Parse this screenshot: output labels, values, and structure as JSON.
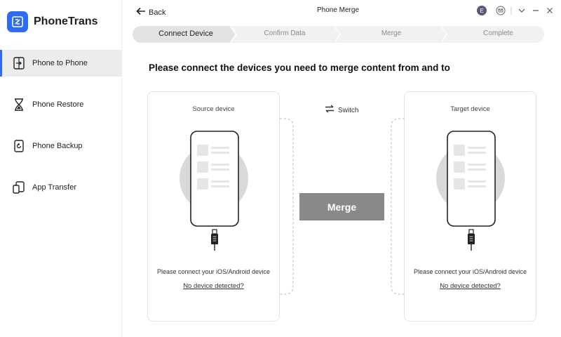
{
  "app": {
    "name": "PhoneTrans",
    "brand_color": "#2f6cf6"
  },
  "sidebar": {
    "items": [
      {
        "label": "Phone to Phone",
        "icon": "phone-to-phone-icon",
        "active": true
      },
      {
        "label": "Phone Restore",
        "icon": "hourglass-icon",
        "active": false
      },
      {
        "label": "Phone Backup",
        "icon": "backup-icon",
        "active": false
      },
      {
        "label": "App Transfer",
        "icon": "app-transfer-icon",
        "active": false
      }
    ]
  },
  "titlebar": {
    "back_label": "Back",
    "title": "Phone Merge",
    "avatar_letter": "E"
  },
  "steps": [
    "Connect Device",
    "Confirm Data",
    "Merge",
    "Complete"
  ],
  "active_step": "Connect Device",
  "headline": "Please connect the devices you need to merge content from and to",
  "switch_label": "Switch",
  "merge_label": "Merge",
  "source": {
    "title": "Source device",
    "message": "Please connect your iOS/Android device",
    "link": "No device detected?"
  },
  "target": {
    "title": "Target device",
    "message": "Please connect your iOS/Android device",
    "link": "No device detected?"
  }
}
